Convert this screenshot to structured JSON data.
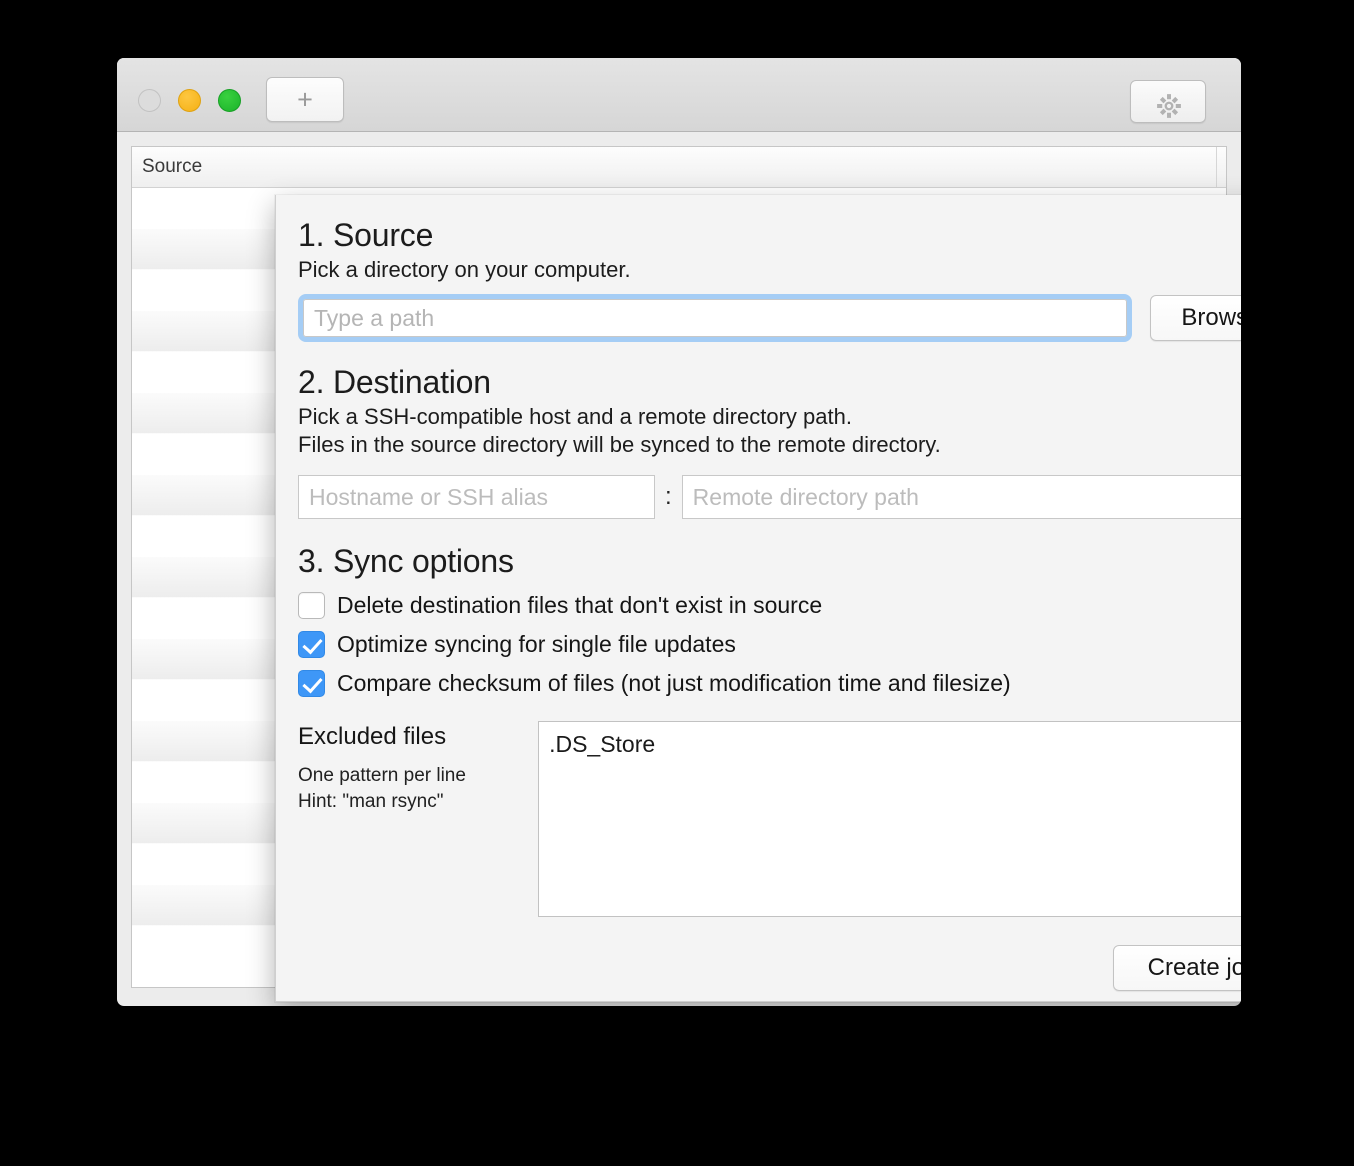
{
  "window": {
    "traffic_lights": [
      "close",
      "minimize",
      "maximize"
    ],
    "new_tab_label": "+",
    "settings_icon": "gear-icon",
    "background_table": {
      "columns": [
        "Source"
      ],
      "row_count": 19
    }
  },
  "sheet": {
    "source": {
      "heading": "1. Source",
      "description": "Pick a directory on your computer.",
      "input_placeholder": "Type a path",
      "input_value": "",
      "browse_label": "Browse",
      "focused": true,
      "focus_ring_color": "#a5cdf5"
    },
    "destination": {
      "heading": "2. Destination",
      "description_line1": "Pick a SSH-compatible host and a remote directory path.",
      "description_line2": "Files in the source directory will be synced to the remote directory.",
      "host_placeholder": "Hostname or SSH alias",
      "host_value": "",
      "separator": ":",
      "remote_placeholder": "Remote directory path",
      "remote_value": ""
    },
    "sync_options": {
      "heading": "3. Sync options",
      "checkbox_color": "#3e97f7",
      "items": [
        {
          "label": "Delete destination files that don't exist in source",
          "checked": false
        },
        {
          "label": "Optimize syncing for single file updates",
          "checked": true
        },
        {
          "label": "Compare checksum of files (not just modification time and filesize)",
          "checked": true
        }
      ]
    },
    "excluded_files": {
      "title": "Excluded files",
      "hint_line1": "One pattern per line",
      "hint_line2": "Hint: \"man rsync\"",
      "value": ".DS_Store"
    },
    "create_job_label": "Create job"
  }
}
